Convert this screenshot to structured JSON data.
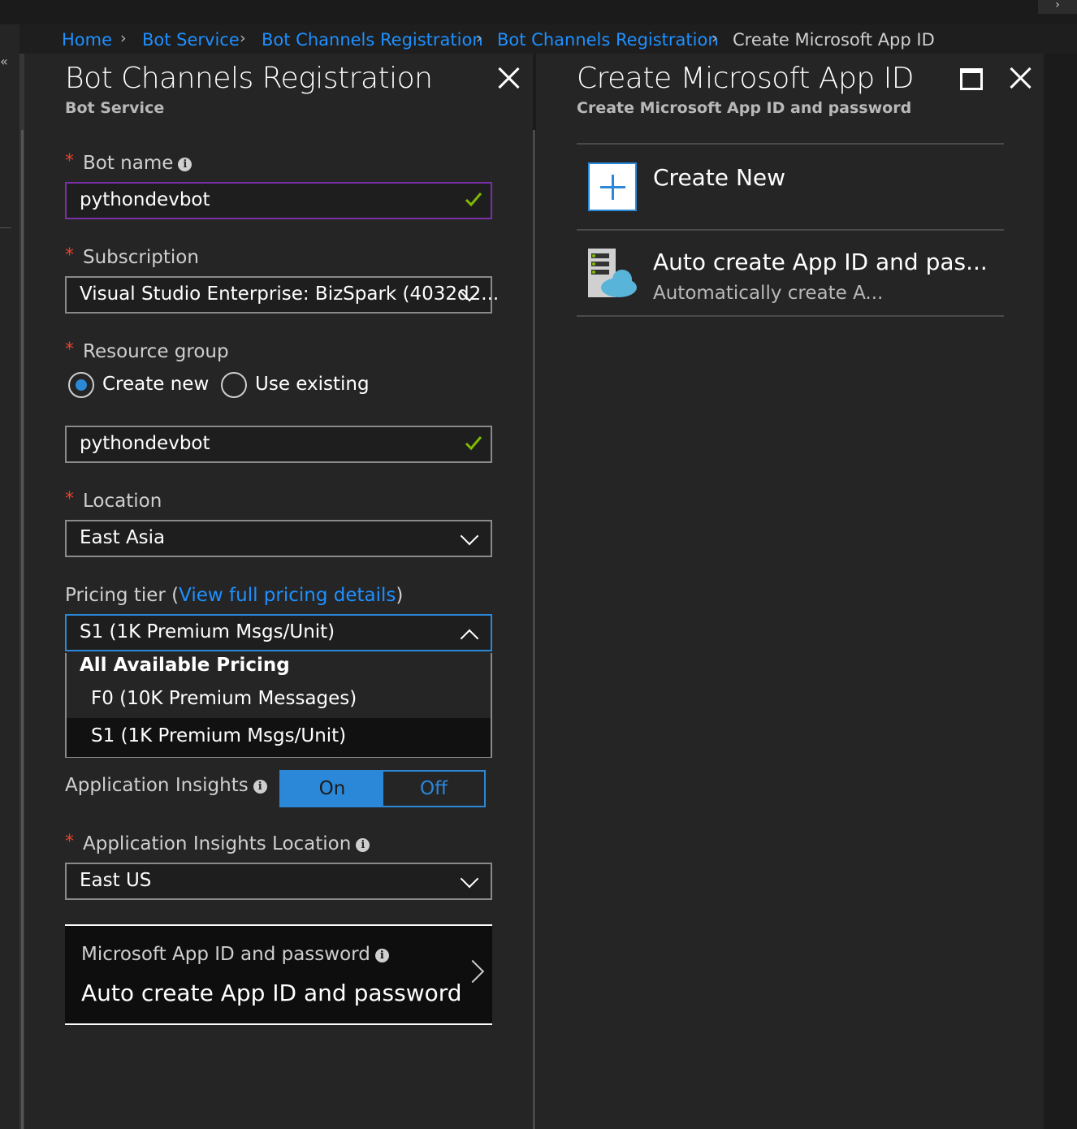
{
  "breadcrumb": {
    "items": [
      "Home",
      "Bot Service",
      "Bot Channels Registration",
      "Bot Channels Registration"
    ],
    "current": "Create Microsoft App ID"
  },
  "blade_left": {
    "title": "Bot Channels Registration",
    "subtitle": "Bot Service",
    "bot_name": {
      "label": "Bot name",
      "value": "pythondevbot"
    },
    "subscription": {
      "label": "Subscription",
      "value": "Visual Studio Enterprise: BizSpark (4032d2..."
    },
    "resource_group": {
      "label": "Resource group",
      "options": [
        "Create new",
        "Use existing"
      ],
      "selected": "Create new",
      "value": "pythondevbot"
    },
    "location": {
      "label": "Location",
      "value": "East Asia"
    },
    "pricing": {
      "label_prefix": "Pricing tier (",
      "link": "View full pricing details",
      "label_suffix": ")",
      "value": "S1 (1K Premium Msgs/Unit)",
      "dropdown_header": "All Available Pricing",
      "options": [
        "F0 (10K Premium Messages)",
        "S1 (1K Premium Msgs/Unit)"
      ],
      "selected": "S1 (1K Premium Msgs/Unit)"
    },
    "app_insights": {
      "label": "Application Insights",
      "on": "On",
      "off": "Off",
      "state": "On"
    },
    "app_insights_location": {
      "label": "Application Insights Location",
      "value": "East US"
    },
    "app_id": {
      "label": "Microsoft App ID and password",
      "value": "Auto create App ID and password"
    }
  },
  "blade_right": {
    "title": "Create Microsoft App ID",
    "subtitle": "Create Microsoft App ID and password",
    "options": [
      {
        "title": "Create New",
        "icon": "plus-icon"
      },
      {
        "title": "Auto create App ID and pas...",
        "subtitle": "Automatically create A...",
        "icon": "server-cloud-icon"
      }
    ]
  },
  "colors": {
    "accent": "#2b88d8",
    "link": "#1e90ff",
    "required": "#e8412c",
    "valid": "#7fba00",
    "focus": "#7b2fa8"
  }
}
